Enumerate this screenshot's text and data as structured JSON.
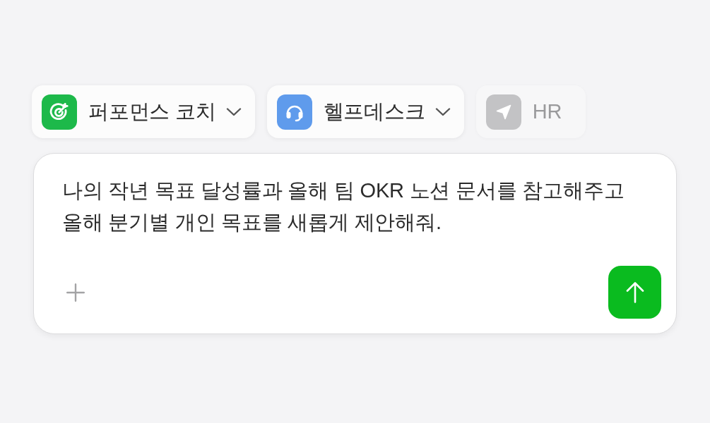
{
  "agent_tabs": [
    {
      "label": "퍼포먼스 코치",
      "kind": "target",
      "color": "#1db94a",
      "menu": true,
      "dimmed": false
    },
    {
      "label": "헬프데스크",
      "kind": "headset",
      "color": "#5f9bec",
      "menu": true,
      "dimmed": false
    },
    {
      "label": "HR",
      "kind": "send",
      "color": "#c3c3c5",
      "menu": false,
      "dimmed": true
    }
  ],
  "composer": {
    "value": "나의 작년 목표 달성률과 올해 팀 OKR 노션 문서를 참고해주고 올해 분기별 개인 목표를 새롭게 제안해줘."
  }
}
